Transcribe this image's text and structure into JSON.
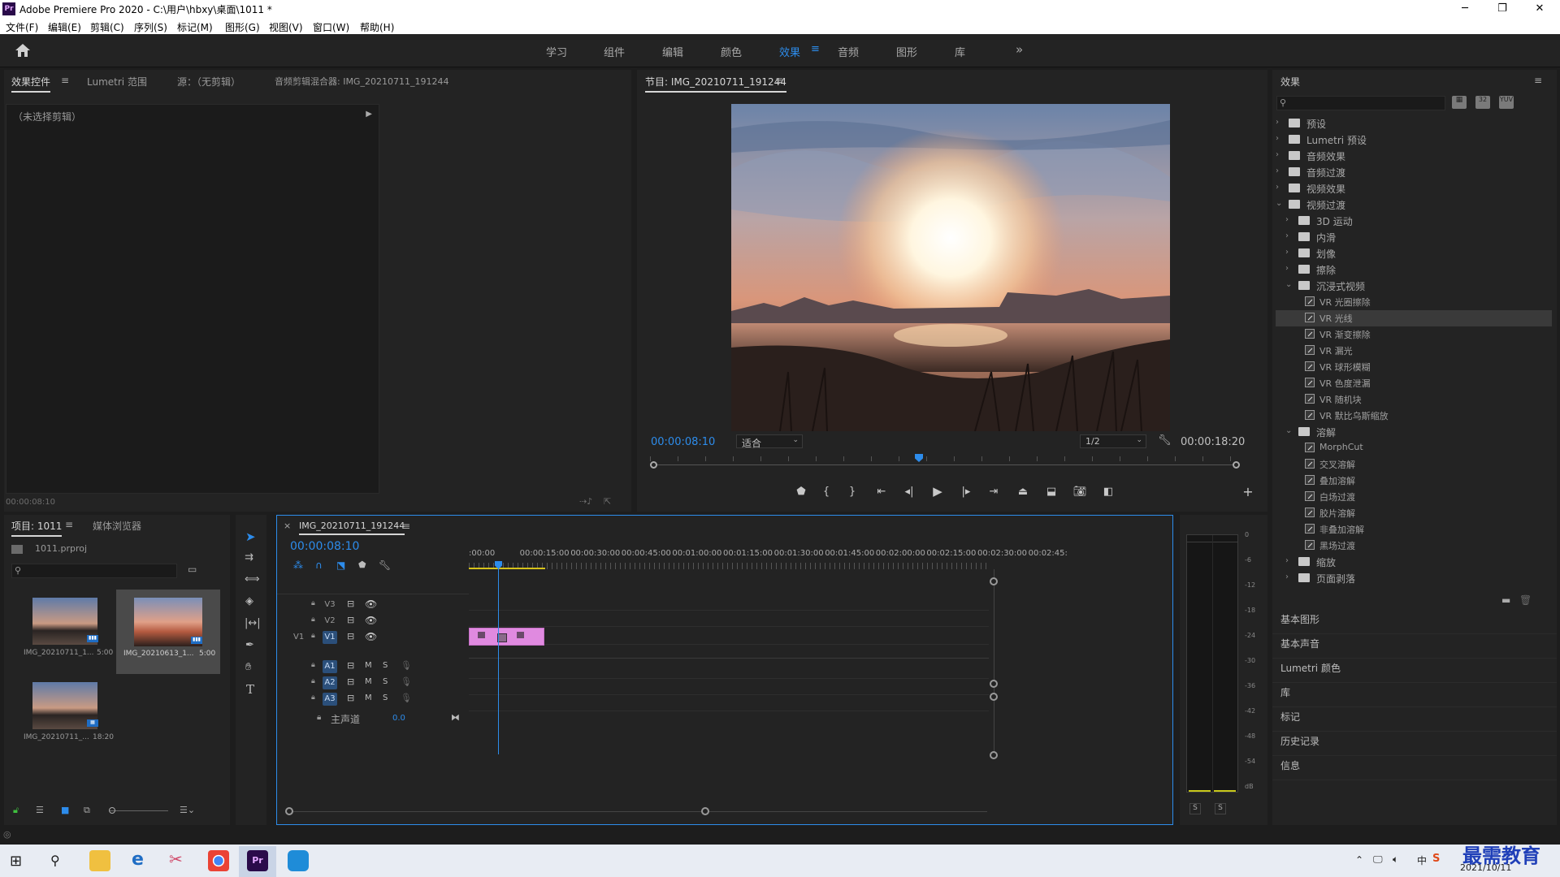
{
  "window": {
    "title": "Adobe Premiere Pro 2020 - C:\\用户\\hbxy\\桌面\\1011 *",
    "logo": "Pr"
  },
  "menu": [
    "文件(F)",
    "编辑(E)",
    "剪辑(C)",
    "序列(S)",
    "标记(M)",
    "图形(G)",
    "视图(V)",
    "窗口(W)",
    "帮助(H)"
  ],
  "workspaces": {
    "items": [
      "学习",
      "组件",
      "编辑",
      "颜色",
      "效果",
      "音频",
      "图形",
      "库"
    ],
    "active": "效果",
    "more": "»"
  },
  "source_panel": {
    "tabs": [
      "效果控件",
      "Lumetri 范围",
      "源：（无剪辑）",
      "音频剪辑混合器: IMG_20210711_191244"
    ],
    "no_clip": "（未选择剪辑）",
    "timecode": "00:00:08:10"
  },
  "program": {
    "title": "节目: IMG_20210711_191244",
    "timecode": "00:00:08:10",
    "fit": "适合",
    "quality": "1/2",
    "duration": "00:00:18:20"
  },
  "effects": {
    "title": "效果",
    "tree": [
      {
        "label": "预设",
        "type": "folder",
        "level": 0,
        "open": false
      },
      {
        "label": "Lumetri 预设",
        "type": "folder",
        "level": 0,
        "open": false
      },
      {
        "label": "音频效果",
        "type": "folder",
        "level": 0,
        "open": false
      },
      {
        "label": "音频过渡",
        "type": "folder",
        "level": 0,
        "open": false
      },
      {
        "label": "视频效果",
        "type": "folder",
        "level": 0,
        "open": false
      },
      {
        "label": "视频过渡",
        "type": "folder",
        "level": 0,
        "open": true
      },
      {
        "label": "3D 运动",
        "type": "folder",
        "level": 1,
        "open": false
      },
      {
        "label": "内滑",
        "type": "folder",
        "level": 1,
        "open": false
      },
      {
        "label": "划像",
        "type": "folder",
        "level": 1,
        "open": false
      },
      {
        "label": "擦除",
        "type": "folder",
        "level": 1,
        "open": false
      },
      {
        "label": "沉浸式视频",
        "type": "folder",
        "level": 1,
        "open": true
      },
      {
        "label": "VR 光圈擦除",
        "type": "fx",
        "level": 2
      },
      {
        "label": "VR 光线",
        "type": "fx",
        "level": 2,
        "selected": true
      },
      {
        "label": "VR 渐变擦除",
        "type": "fx",
        "level": 2
      },
      {
        "label": "VR 漏光",
        "type": "fx",
        "level": 2
      },
      {
        "label": "VR 球形模糊",
        "type": "fx",
        "level": 2
      },
      {
        "label": "VR 色度泄漏",
        "type": "fx",
        "level": 2
      },
      {
        "label": "VR 随机块",
        "type": "fx",
        "level": 2
      },
      {
        "label": "VR 默比乌斯缩放",
        "type": "fx",
        "level": 2
      },
      {
        "label": "溶解",
        "type": "folder",
        "level": 1,
        "open": true
      },
      {
        "label": "MorphCut",
        "type": "fx",
        "level": 2
      },
      {
        "label": "交叉溶解",
        "type": "fx",
        "level": 2
      },
      {
        "label": "叠加溶解",
        "type": "fx",
        "level": 2
      },
      {
        "label": "白场过渡",
        "type": "fx",
        "level": 2
      },
      {
        "label": "胶片溶解",
        "type": "fx",
        "level": 2
      },
      {
        "label": "非叠加溶解",
        "type": "fx",
        "level": 2
      },
      {
        "label": "黑场过渡",
        "type": "fx",
        "level": 2
      },
      {
        "label": "缩放",
        "type": "folder",
        "level": 1,
        "open": false
      },
      {
        "label": "页面剥落",
        "type": "folder",
        "level": 1,
        "open": false
      }
    ],
    "sections": [
      "基本图形",
      "基本声音",
      "Lumetri 颜色",
      "库",
      "标记",
      "历史记录",
      "信息"
    ]
  },
  "project": {
    "tabs": [
      "项目: 1011",
      "媒体浏览器"
    ],
    "file": "1011.prproj",
    "items": [
      {
        "name": "IMG_20210711_1...",
        "dur": "5:00"
      },
      {
        "name": "IMG_20210613_1...",
        "dur": "5:00"
      },
      {
        "name": "IMG_20210711_...",
        "dur": "18:20"
      }
    ]
  },
  "timeline": {
    "close": "×",
    "title": "IMG_20210711_191244",
    "timecode": "00:00:08:10",
    "ruler": [
      ":00:00",
      "00:00:15:00",
      "00:00:30:00",
      "00:00:45:00",
      "00:01:00:00",
      "00:01:15:00",
      "00:01:30:00",
      "00:01:45:00",
      "00:02:00:00",
      "00:02:15:00",
      "00:02:30:00",
      "00:02:45:"
    ],
    "video_tracks": [
      "V3",
      "V2",
      "V1"
    ],
    "audio_tracks": [
      "A1",
      "A2",
      "A3"
    ],
    "src_patch": "V1",
    "master": "主声道",
    "master_val": "0.0",
    "m": "M",
    "s": "S"
  },
  "meter": {
    "scale": [
      "0",
      "-6",
      "-12",
      "-18",
      "-24",
      "-30",
      "-36",
      "-42",
      "-48",
      "-54",
      "dB"
    ],
    "solo": [
      "S",
      "S"
    ]
  },
  "taskbar": {
    "date": "2021/10/11",
    "ime": "中",
    "watermark": "最需教育"
  }
}
